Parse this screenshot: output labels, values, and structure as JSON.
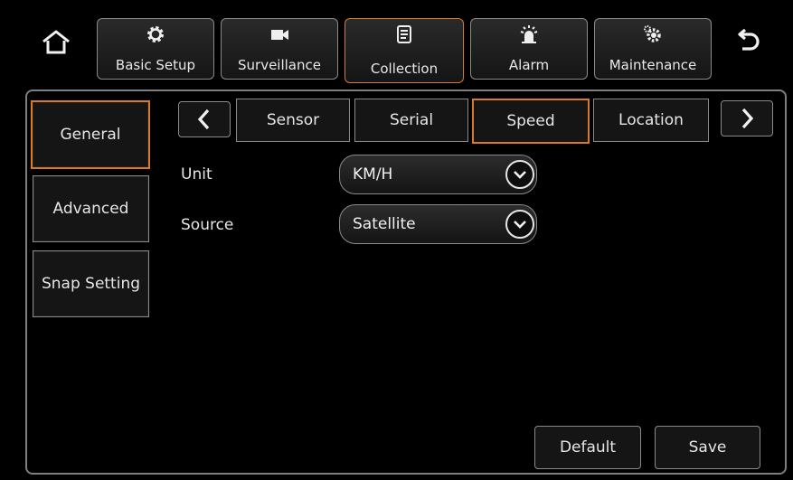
{
  "top_nav": {
    "home_icon": "home-icon",
    "back_icon": "back-arrow-icon",
    "items": [
      {
        "label": "Basic Setup",
        "icon": "gear-icon"
      },
      {
        "label": "Surveillance",
        "icon": "camera-icon"
      },
      {
        "label": "Collection",
        "icon": "document-icon",
        "active": true
      },
      {
        "label": "Alarm",
        "icon": "alarm-light-icon"
      },
      {
        "label": "Maintenance",
        "icon": "gears-icon"
      }
    ]
  },
  "sidebar": {
    "items": [
      {
        "label": "General",
        "active": true
      },
      {
        "label": "Advanced"
      },
      {
        "label": "Snap Setting"
      }
    ]
  },
  "tabs": {
    "items": [
      {
        "label": "Sensor"
      },
      {
        "label": "Serial"
      },
      {
        "label": "Speed",
        "active": true
      },
      {
        "label": "Location"
      }
    ]
  },
  "form": {
    "unit": {
      "label": "Unit",
      "value": "KM/H"
    },
    "source": {
      "label": "Source",
      "value": "Satellite"
    }
  },
  "actions": {
    "default_label": "Default",
    "save_label": "Save"
  },
  "colors": {
    "accent": "#d9792b",
    "border": "#8a8a8a",
    "background": "#000000"
  }
}
